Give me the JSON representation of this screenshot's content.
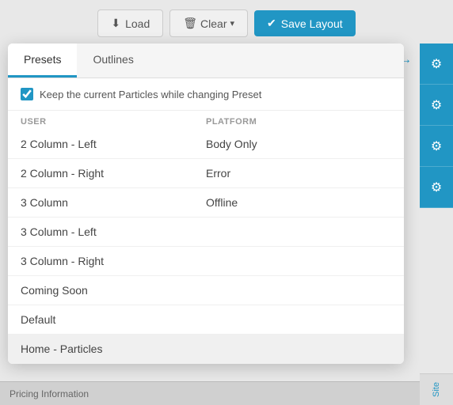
{
  "toolbar": {
    "load_label": "Load",
    "clear_label": "Clear",
    "save_label": "Save Layout",
    "load_icon": "⬇",
    "clear_icon": "🗑",
    "save_icon": "✔",
    "chevron_icon": "▾"
  },
  "popup": {
    "tabs": [
      {
        "id": "presets",
        "label": "Presets",
        "active": true
      },
      {
        "id": "outlines",
        "label": "Outlines",
        "active": false
      }
    ],
    "checkbox_label": "Keep the current Particles while changing Preset",
    "checkbox_checked": true,
    "columns": {
      "user_header": "USER",
      "platform_header": "PLATFORM"
    },
    "user_presets": [
      {
        "label": "2 Column - Left",
        "active": false
      },
      {
        "label": "2 Column - Right",
        "active": false
      },
      {
        "label": "3 Column",
        "active": false
      },
      {
        "label": "3 Column - Left",
        "active": false
      },
      {
        "label": "3 Column - Right",
        "active": false
      },
      {
        "label": "Coming Soon",
        "active": false
      },
      {
        "label": "Default",
        "active": false
      },
      {
        "label": "Home - Particles",
        "active": true
      }
    ],
    "platform_presets": [
      {
        "label": "Body Only"
      },
      {
        "label": "Error"
      },
      {
        "label": "Offline"
      }
    ]
  },
  "right_panel": {
    "undo_icon": "↩",
    "undo_arrow": "→",
    "gear_icon": "⚙",
    "site_label": "Site"
  },
  "bottom_bar": {
    "label": "Pricing Information"
  }
}
